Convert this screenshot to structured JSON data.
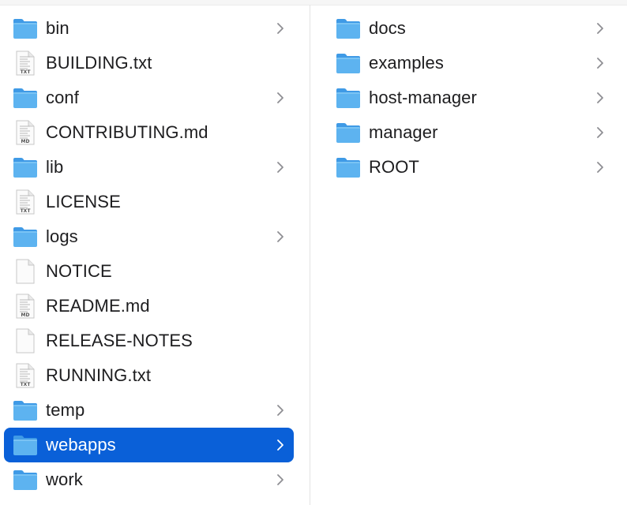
{
  "columns": [
    {
      "items": [
        {
          "name": "bin",
          "kind": "folder",
          "icon": "folder-icon",
          "has_children": true,
          "selected": false
        },
        {
          "name": "BUILDING.txt",
          "kind": "document",
          "icon": "text-document-icon",
          "tag": "TXT",
          "has_children": false,
          "selected": false
        },
        {
          "name": "conf",
          "kind": "folder",
          "icon": "folder-icon",
          "has_children": true,
          "selected": false
        },
        {
          "name": "CONTRIBUTING.md",
          "kind": "document",
          "icon": "markdown-document-icon",
          "tag": "MD",
          "has_children": false,
          "selected": false
        },
        {
          "name": "lib",
          "kind": "folder",
          "icon": "folder-icon",
          "has_children": true,
          "selected": false
        },
        {
          "name": "LICENSE",
          "kind": "document",
          "icon": "text-document-icon",
          "tag": "TXT",
          "has_children": false,
          "selected": false
        },
        {
          "name": "logs",
          "kind": "folder",
          "icon": "folder-icon",
          "has_children": true,
          "selected": false
        },
        {
          "name": "NOTICE",
          "kind": "blank",
          "icon": "blank-document-icon",
          "has_children": false,
          "selected": false
        },
        {
          "name": "README.md",
          "kind": "document",
          "icon": "markdown-document-icon",
          "tag": "MD",
          "has_children": false,
          "selected": false
        },
        {
          "name": "RELEASE-NOTES",
          "kind": "blank",
          "icon": "blank-document-icon",
          "has_children": false,
          "selected": false
        },
        {
          "name": "RUNNING.txt",
          "kind": "document",
          "icon": "text-document-icon",
          "tag": "TXT",
          "has_children": false,
          "selected": false
        },
        {
          "name": "temp",
          "kind": "folder",
          "icon": "folder-icon",
          "has_children": true,
          "selected": false
        },
        {
          "name": "webapps",
          "kind": "folder",
          "icon": "folder-icon",
          "has_children": true,
          "selected": true
        },
        {
          "name": "work",
          "kind": "folder",
          "icon": "folder-icon",
          "has_children": true,
          "selected": false
        }
      ]
    },
    {
      "items": [
        {
          "name": "docs",
          "kind": "folder",
          "icon": "folder-icon",
          "has_children": true,
          "selected": false
        },
        {
          "name": "examples",
          "kind": "folder",
          "icon": "folder-icon",
          "has_children": true,
          "selected": false
        },
        {
          "name": "host-manager",
          "kind": "folder",
          "icon": "folder-icon",
          "has_children": true,
          "selected": false
        },
        {
          "name": "manager",
          "kind": "folder",
          "icon": "folder-icon",
          "has_children": true,
          "selected": false
        },
        {
          "name": "ROOT",
          "kind": "folder",
          "icon": "folder-icon",
          "has_children": true,
          "selected": false
        }
      ]
    }
  ],
  "colors": {
    "selection": "#0a60d8",
    "folder_body": "#5db3f0",
    "folder_tab": "#3f9ae6",
    "chevron": "#8e8e93",
    "chevron_selected": "#ffffff"
  }
}
